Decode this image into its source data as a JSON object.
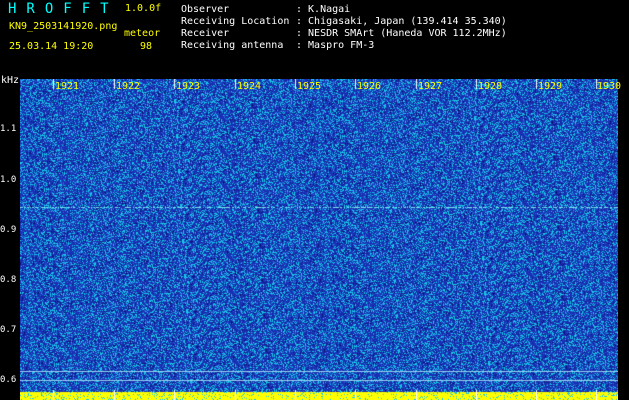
{
  "header": {
    "logo": "HROFFT",
    "version": "1.0.0f",
    "filename": "KN9_2503141920.png",
    "datetime": "25.03.14 19:20",
    "meteor_label": "meteor",
    "meteor_count": "98",
    "info": [
      {
        "label": "Observer",
        "value": ": K.Nagai"
      },
      {
        "label": "Receiving Location",
        "value": ": Chigasaki, Japan (139.414 35.340)"
      },
      {
        "label": "Receiver",
        "value": ": NESDR SMArt (Haneda VOR 112.2MHz)"
      },
      {
        "label": "Receiving antenna",
        "value": ": Maspro FM-3"
      }
    ]
  },
  "spectrogram": {
    "y_unit": "kHz",
    "y_ticks": [
      "1.1",
      "1.0",
      "0.9",
      "0.8",
      "0.7",
      "0.6"
    ],
    "x_ticks": [
      "1921",
      "1922",
      "1923",
      "1924",
      "1925",
      "1926",
      "1927",
      "1928",
      "1929",
      "1930"
    ],
    "colors": {
      "background": "#1a2fb4",
      "noise": "#18c8e8",
      "bottom_bar": "#ffff00"
    }
  }
}
